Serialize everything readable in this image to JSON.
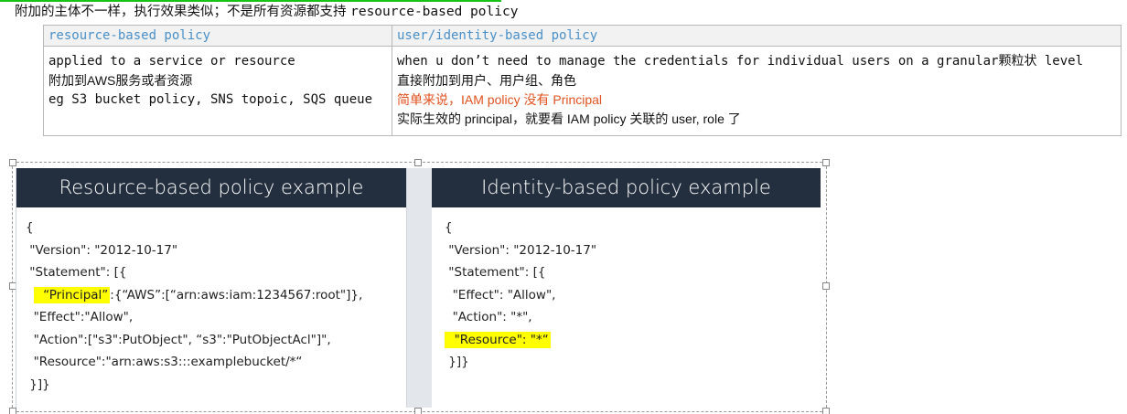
{
  "intro": {
    "prefix": "附加的主体不一样，执行效果类似；不是所有资源都支持 ",
    "suffix": "resource-based policy"
  },
  "table": {
    "headers": [
      "resource-based policy",
      "user/identity-based policy"
    ],
    "col1_lines": [
      "applied to a service or resource",
      "附加到AWS服务或者资源",
      "eg S3 bucket policy, SNS topoic, SQS queue"
    ],
    "col2_lines": [
      "when u don’t need to manage the credentials for individual users on a granular颗粒状 level",
      "直接附加到用户、用户组、角色",
      "简单来说，IAM policy 没有 Principal",
      "实际生效的 principal，就要看 IAM policy 关联的 user, role 了"
    ],
    "highlight_color": "#e0521f"
  },
  "slide": {
    "header_bg": "#232f3e",
    "left": {
      "title": "Resource-based policy example",
      "lines": [
        "{",
        " \"Version\": \"2012-10-17\"",
        " \"Statement\": [{",
        "  “Principal”",
        "  \"Effect\":\"Allow\",",
        "  \"Action\":[\"s3\":PutObject\", “s3\":\"PutObjectAcl\"]\",",
        "  \"Resource\":\"arn:aws:s3:::examplebucket/*“",
        " }]}"
      ],
      "principal_rest": ":{“AWS”:[“arn:aws:iam:1234567:root\"]},"
    },
    "right": {
      "title": "Identity-based policy example",
      "lines": [
        "{",
        " \"Version\": \"2012-10-17\"",
        " \"Statement\": [{",
        "  \"Effect\": \"Allow\",",
        "  \"Action\": \"*\",",
        "  \"Resource\": \"*“",
        " }]}"
      ]
    }
  }
}
